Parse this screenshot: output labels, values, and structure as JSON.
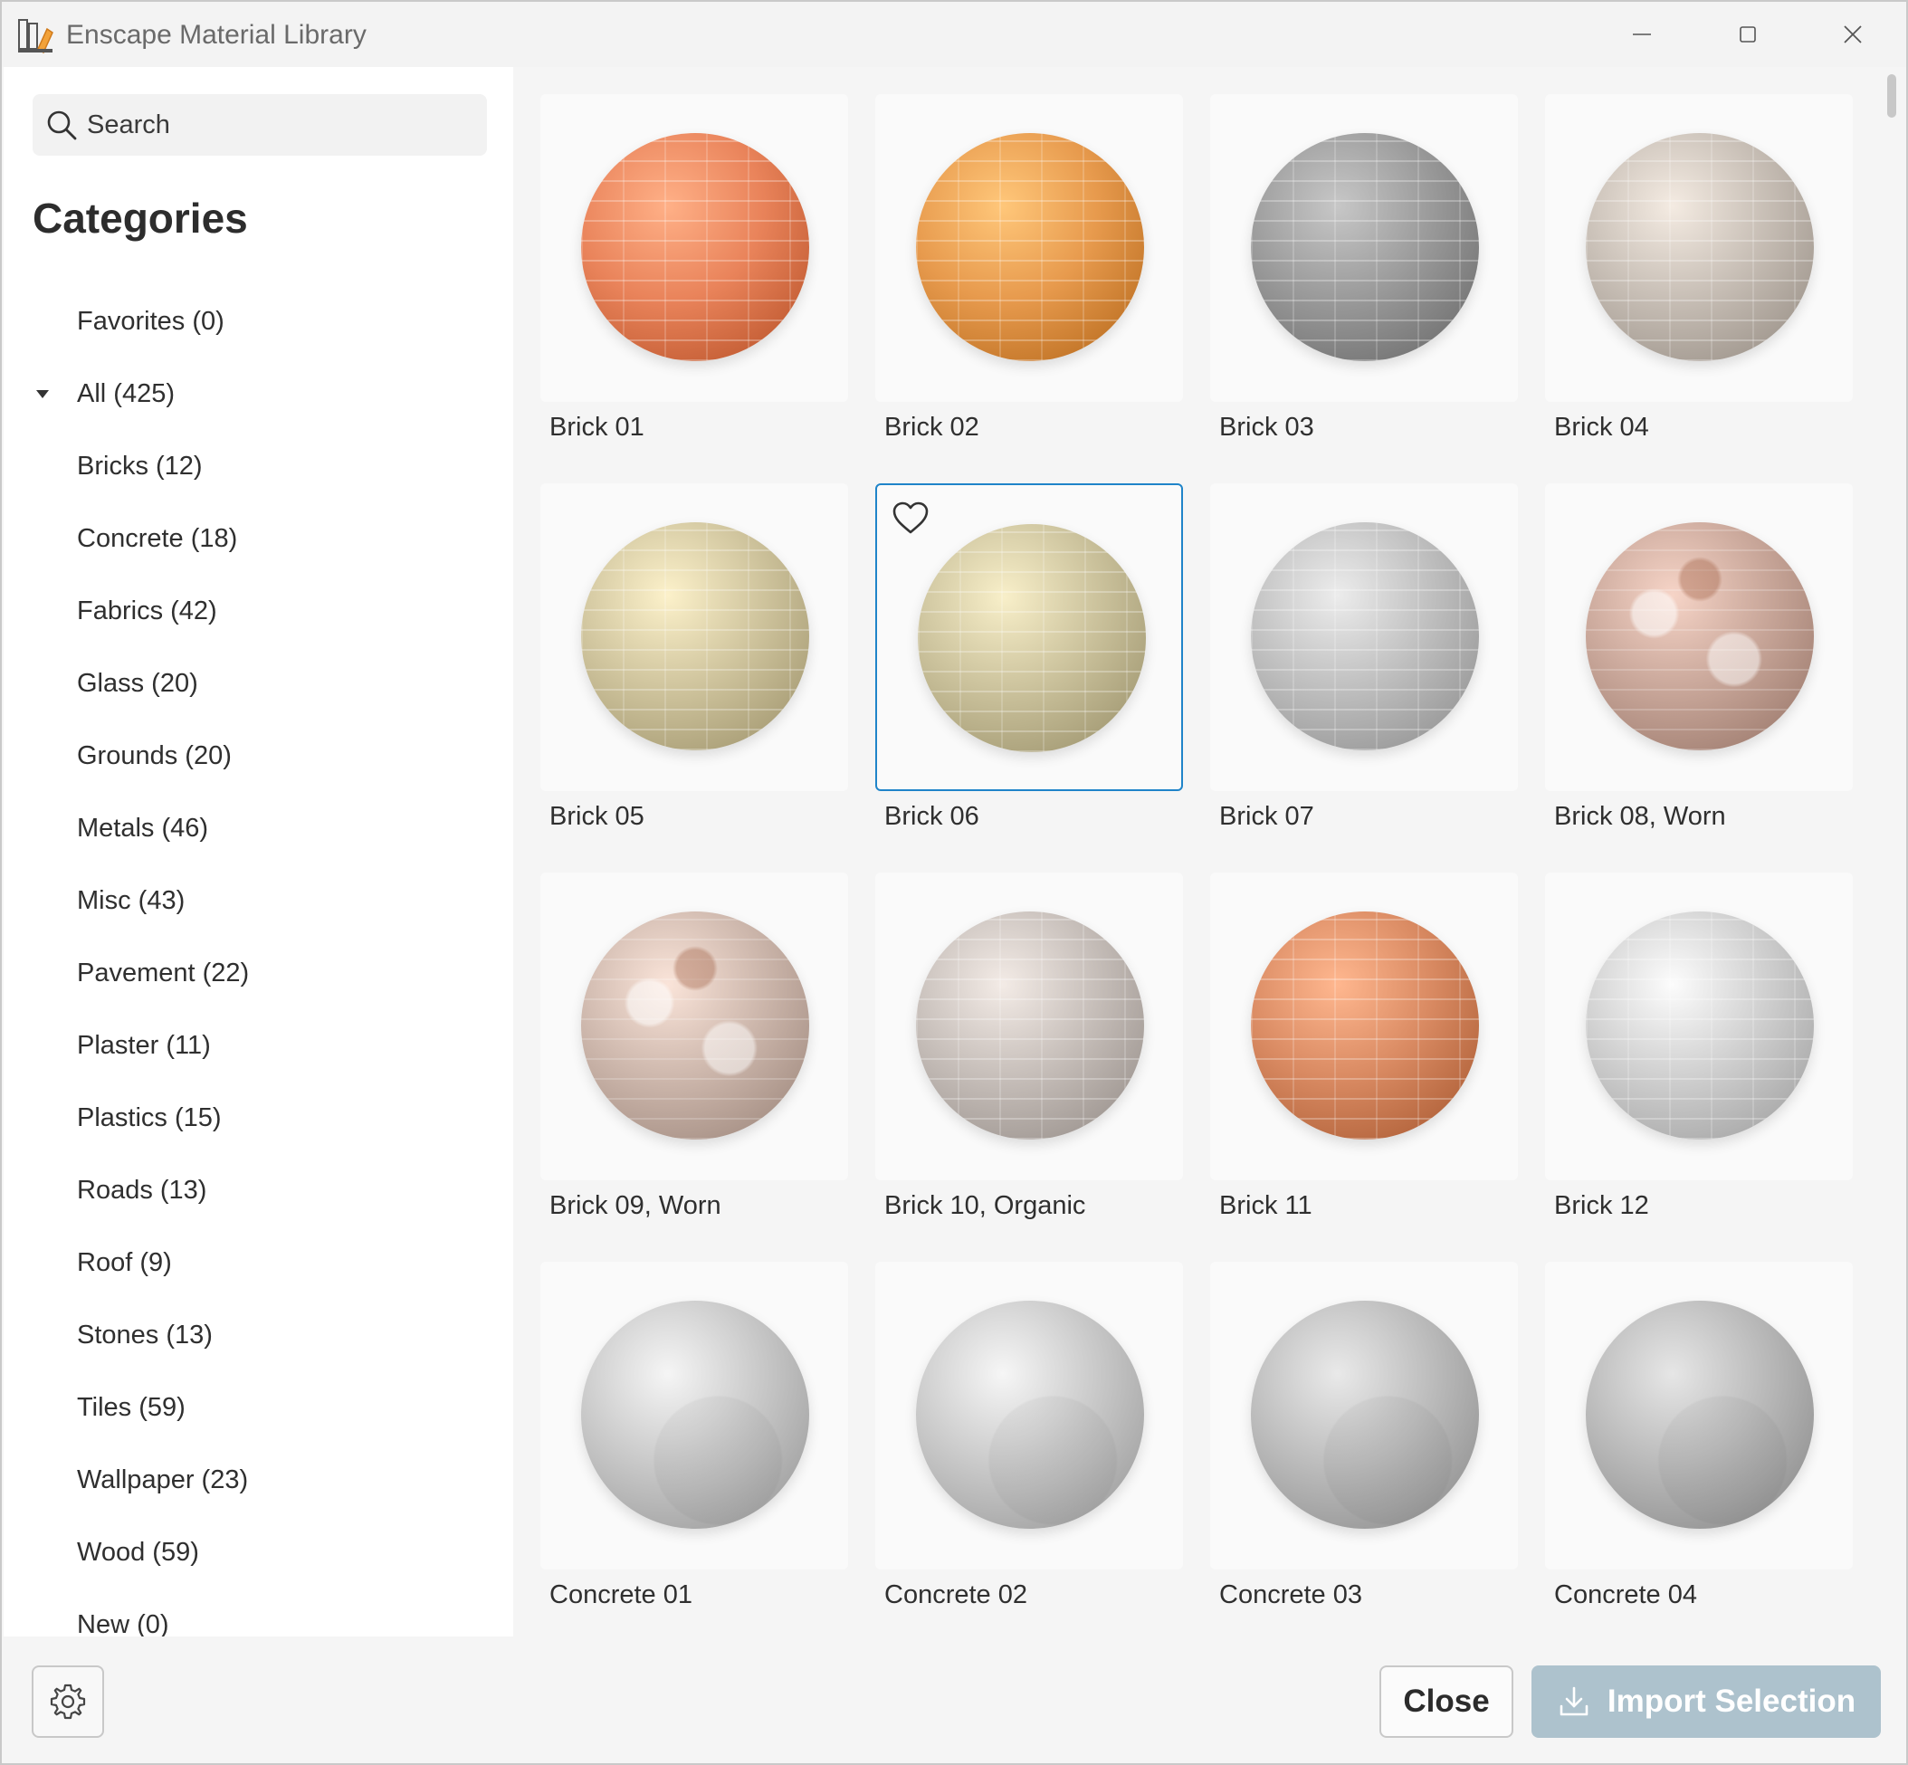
{
  "window": {
    "title": "Enscape Material Library",
    "controls": [
      "minimize-icon",
      "maximize-icon",
      "close-icon"
    ]
  },
  "search": {
    "placeholder": "Search",
    "value": ""
  },
  "sidebar": {
    "title": "Categories",
    "items": [
      {
        "label": "Favorites (0)",
        "expandable": false
      },
      {
        "label": "All (425)",
        "expandable": true,
        "expanded": true
      },
      {
        "label": "Bricks (12)",
        "expandable": false
      },
      {
        "label": "Concrete (18)",
        "expandable": false
      },
      {
        "label": "Fabrics (42)",
        "expandable": false
      },
      {
        "label": "Glass (20)",
        "expandable": false
      },
      {
        "label": "Grounds (20)",
        "expandable": false
      },
      {
        "label": "Metals (46)",
        "expandable": false
      },
      {
        "label": "Misc (43)",
        "expandable": false
      },
      {
        "label": "Pavement (22)",
        "expandable": false
      },
      {
        "label": "Plaster (11)",
        "expandable": false
      },
      {
        "label": "Plastics (15)",
        "expandable": false
      },
      {
        "label": "Roads (13)",
        "expandable": false
      },
      {
        "label": "Roof (9)",
        "expandable": false
      },
      {
        "label": "Stones (13)",
        "expandable": false
      },
      {
        "label": "Tiles (59)",
        "expandable": false
      },
      {
        "label": "Wallpaper (23)",
        "expandable": false
      },
      {
        "label": "Wood (59)",
        "expandable": false
      },
      {
        "label": "New (0)",
        "expandable": false
      }
    ]
  },
  "materials": [
    {
      "name": "Brick 01",
      "color": "#e9835a",
      "pattern": "brick",
      "selected": false
    },
    {
      "name": "Brick 02",
      "color": "#e79a4d",
      "pattern": "brick",
      "selected": false
    },
    {
      "name": "Brick 03",
      "color": "#9a9a9a",
      "pattern": "brick",
      "selected": false
    },
    {
      "name": "Brick 04",
      "color": "#c7beb5",
      "pattern": "brick",
      "selected": false
    },
    {
      "name": "Brick 05",
      "color": "#cfc49d",
      "pattern": "brick",
      "selected": false
    },
    {
      "name": "Brick 06",
      "color": "#cbc29c",
      "pattern": "brick",
      "selected": true
    },
    {
      "name": "Brick 07",
      "color": "#bfbfbf",
      "pattern": "brick",
      "selected": false
    },
    {
      "name": "Brick 08, Worn",
      "color": "#c9a79a",
      "pattern": "worn",
      "selected": false
    },
    {
      "name": "Brick 09, Worn",
      "color": "#cdb7ac",
      "pattern": "worn",
      "selected": false
    },
    {
      "name": "Brick 10, Organic",
      "color": "#c6beb9",
      "pattern": "brick",
      "selected": false
    },
    {
      "name": "Brick 11",
      "color": "#d98a62",
      "pattern": "brick",
      "selected": false
    },
    {
      "name": "Brick 12",
      "color": "#cfcfcf",
      "pattern": "brick",
      "selected": false
    },
    {
      "name": "Concrete 01",
      "color": "#c8c8c8",
      "pattern": "plain",
      "selected": false
    },
    {
      "name": "Concrete 02",
      "color": "#c9c9c9",
      "pattern": "plain",
      "selected": false
    },
    {
      "name": "Concrete 03",
      "color": "#bcbcbc",
      "pattern": "plain",
      "selected": false
    },
    {
      "name": "Concrete 04",
      "color": "#b9b9b9",
      "pattern": "plain",
      "selected": false
    }
  ],
  "footer": {
    "close_label": "Close",
    "import_label": "Import Selection"
  },
  "colors": {
    "selection_border": "#1f84c9",
    "import_button_bg": "#adc2cd"
  }
}
